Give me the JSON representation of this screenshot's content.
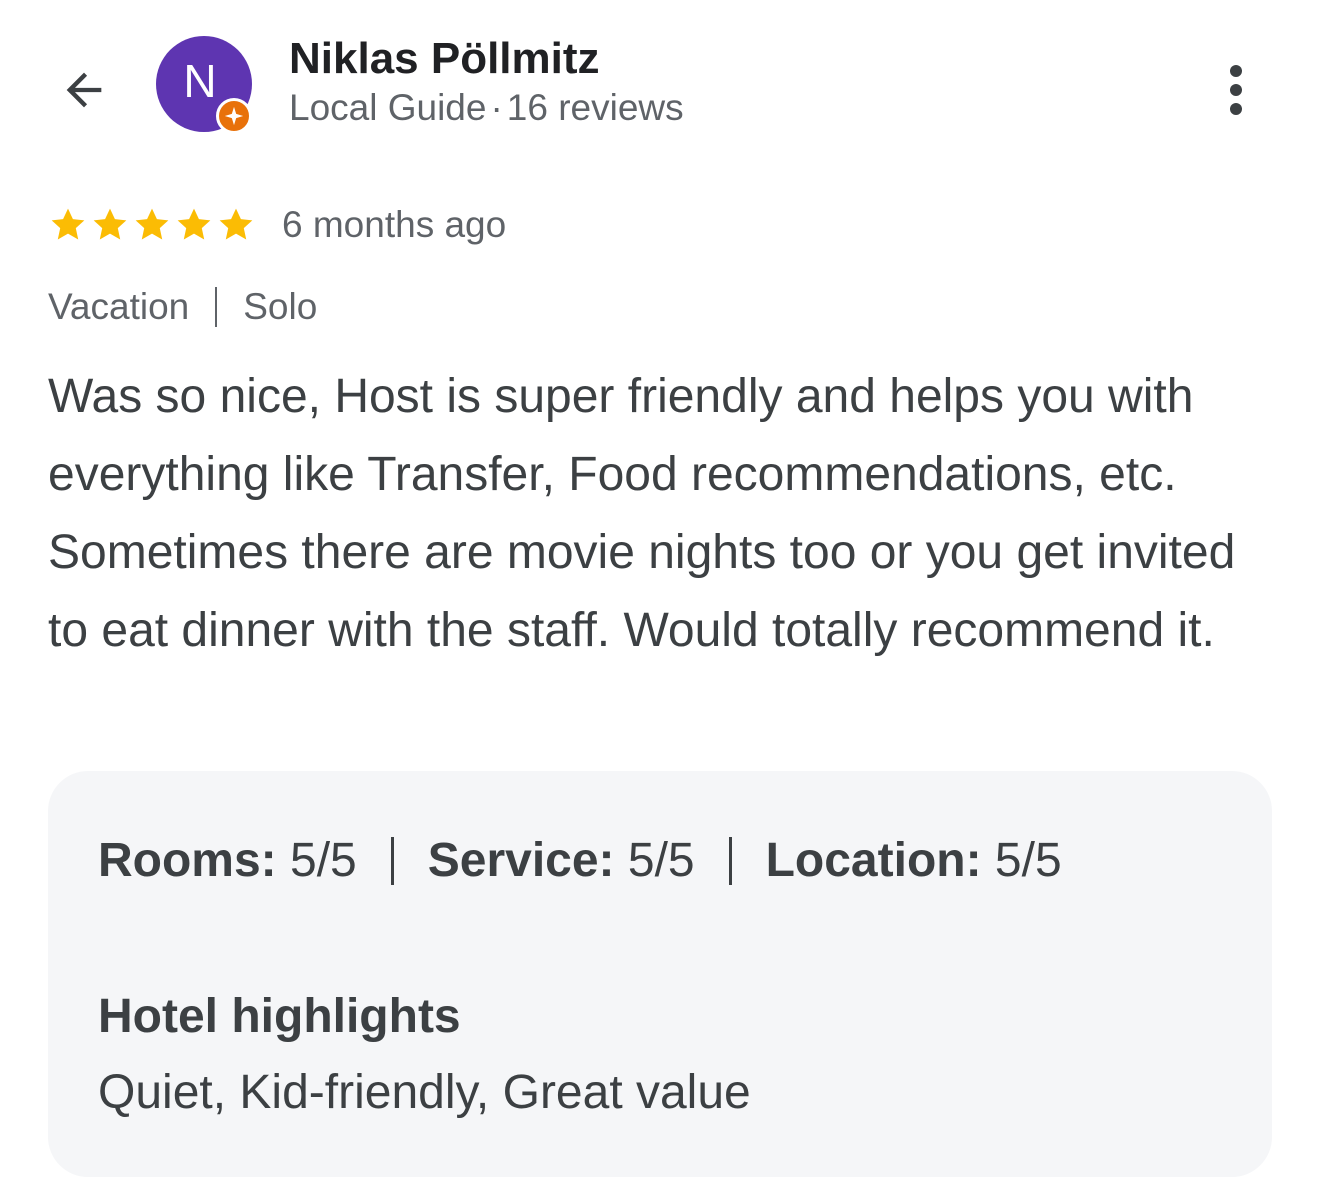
{
  "header": {
    "back_icon": "arrow-back-icon",
    "avatar_letter": "N",
    "avatar_color": "#5e35b1",
    "badge_icon": "local-guide-badge-icon",
    "badge_color": "#e8710a",
    "reviewer_name": "Niklas Pöllmitz",
    "reviewer_role": "Local Guide",
    "separator": "·",
    "review_count": "16 reviews",
    "more_icon": "more-vertical-icon"
  },
  "review": {
    "stars": 5,
    "max_stars": 5,
    "star_color": "#fbbc04",
    "time_ago": "6 months ago",
    "trip_type": "Vacation",
    "travel_group": "Solo",
    "text": "Was so nice, Host is super friendly and helps you with everything like Transfer, Food recommendations, etc. Sometimes there are movie nights too or you get invited to eat dinner with the staff. Would totally recommend it."
  },
  "details": {
    "ratings": [
      {
        "label": "Rooms",
        "value": "5/5"
      },
      {
        "label": "Service",
        "value": "5/5"
      },
      {
        "label": "Location",
        "value": "5/5"
      }
    ],
    "highlights_title": "Hotel highlights",
    "highlights": "Quiet, Kid-friendly, Great value"
  }
}
